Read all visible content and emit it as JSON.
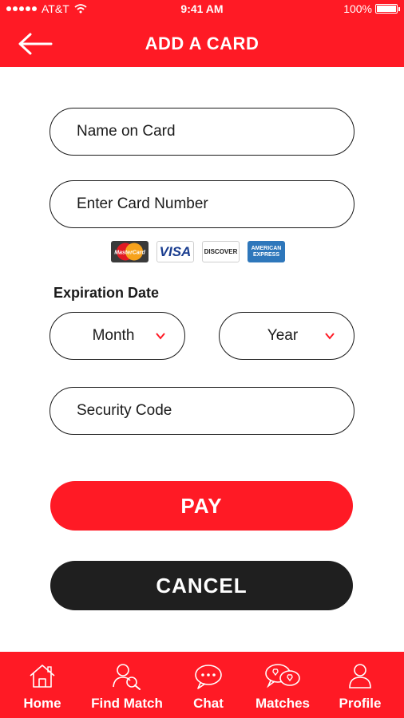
{
  "status_bar": {
    "carrier": "AT&T",
    "time": "9:41 AM",
    "battery": "100%"
  },
  "header": {
    "title": "ADD A CARD"
  },
  "form": {
    "name_placeholder": "Name on Card",
    "card_number_placeholder": "Enter Card Number",
    "expiration_label": "Expiration Date",
    "month_value": "Month",
    "year_value": "Year",
    "security_placeholder": "Security Code"
  },
  "card_logos": {
    "mastercard": "MasterCard",
    "visa": "VISA",
    "discover": "DISCOVER",
    "amex_line1": "AMERICAN",
    "amex_line2": "EXPRESS"
  },
  "buttons": {
    "pay": "PAY",
    "cancel": "CANCEL"
  },
  "tabbar": {
    "items": [
      {
        "label": "Home",
        "icon": "home-icon"
      },
      {
        "label": "Find Match",
        "icon": "find-match-icon"
      },
      {
        "label": "Chat",
        "icon": "chat-icon"
      },
      {
        "label": "Matches",
        "icon": "matches-icon"
      },
      {
        "label": "Profile",
        "icon": "profile-icon"
      }
    ]
  },
  "colors": {
    "accent": "#ff1a25",
    "dark": "#1f1f1f",
    "white": "#ffffff"
  }
}
